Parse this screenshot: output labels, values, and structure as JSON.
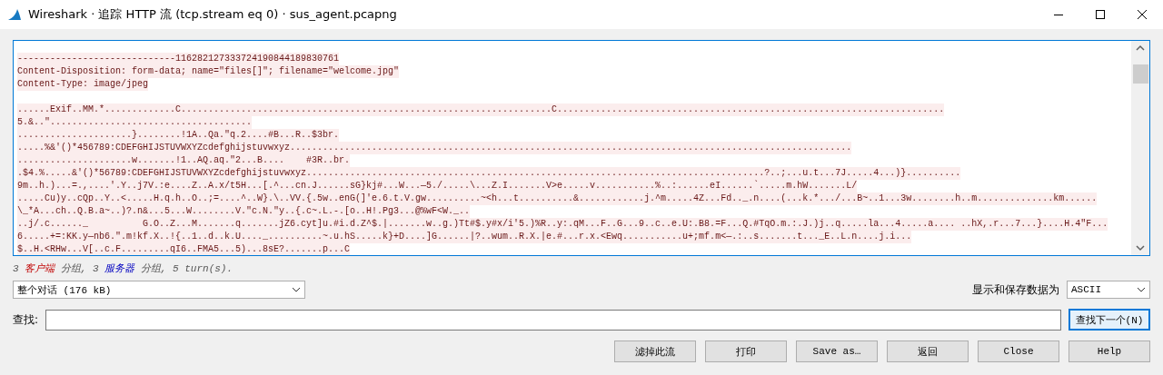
{
  "window": {
    "title": "Wireshark · 追踪 HTTP 流 (tcp.stream eq 0) · sus_agent.pcapng"
  },
  "stream": {
    "lines": [
      {
        "kind": "data",
        "color": "#fbeded",
        "text": "-----------------------------116282127333724190844189830761"
      },
      {
        "kind": "data",
        "color": "#fbeded",
        "text": "Content-Disposition: form-data; name=\"files[]\"; filename=\"welcome.jpg\""
      },
      {
        "kind": "data",
        "color": "#fbeded",
        "text": "Content-Type: image/jpeg"
      },
      {
        "kind": "blank"
      },
      {
        "kind": "data",
        "color": "#fbeded",
        "text": "......Exif..MM.*.............C....................................................................C......................................................................."
      },
      {
        "kind": "data",
        "color": "#fbeded",
        "text": "5.&..\"....................................."
      },
      {
        "kind": "data",
        "color": "#fbeded",
        "text": ".....................}........!1A..Qa.\"q.2....#B...R..$3br."
      },
      {
        "kind": "data",
        "color": "#fbeded",
        "text": ".....%&'()*456789:CDEFGHIJSTUVWXYZcdefghijstuvwxyz......................................................................................................."
      },
      {
        "kind": "data",
        "color": "#fbeded",
        "text": ".....................w.......!1..AQ.aq.\"2...B....    #3R..br."
      },
      {
        "kind": "data",
        "color": "#fbeded",
        "text": ".$4.%.....&'()*56789:CDEFGHIJSTUVWXYZcdefghijstuvwxyz....................................................................................?..;...u.t...7J.....4...)}.........."
      },
      {
        "kind": "data",
        "color": "#fbeded",
        "text": "9m..h.)...=.,....'.Y..j7V.:e....Z..A.x/t5H...[.^...cn.J......sG}kj#...W...—5./.....\\...Z.I.......V>e.....v...........%..:......eI......`.....m.hW.......L/"
      },
      {
        "kind": "data",
        "color": "#fbeded",
        "text": ".....Cu)y..cQp..Y..<.....H.q.h..O..;=....^..W}.\\..VV.{.5w..enG(]'e.6.t.V.gw..........~<h...t..........&............j.^m.....4Z...Fd.._.n....(...k.*.../...B~..1...3w........h..m..............km......"
      },
      {
        "kind": "data",
        "color": "#fbeded",
        "text": "\\_*A...ch..Q.B.a~..)?.n&...5...W........V.\"c.N.\"y..{.c~.L.-.[o..H!.Pg3...@%wF<W._.."
      },
      {
        "kind": "data",
        "color": "#fbeded",
        "text": "..j/.c......_          G.O..Z...M.......q.......jZ6.cyt]u.#i.d.Z^$.|.......w..g.)Tt#$.y#x/i'5.)%R..y:.qM...F..G...9..c..e.U:.B8.=F...Q.#TqO.m.:.J.)j..q.....la...4.....a.... ..hX,.r...7...}....H.4\"F..."
      },
      {
        "kind": "data",
        "color": "#fbeded",
        "text": "6.....+=:KK.y—nb6.\".m!kf.X..!{..1..d..k.U...._..........~.u.hS.....k}+D....]G......|?..wum..R.X.|e.#...r.x.<Ewq...........u+;mf.m<—.:..s.......t..._E..L.n....j.i..."
      },
      {
        "kind": "data",
        "color": "#fbeded",
        "text": "$..H.<RHw...V[..c.F.........qI6..FMA5...5)...8sE?.......p...C"
      }
    ]
  },
  "status": {
    "parts": [
      {
        "kind": "plain",
        "text": "3 "
      },
      {
        "kind": "client",
        "text": "客户端"
      },
      {
        "kind": "plain",
        "text": " 分组, 3 "
      },
      {
        "kind": "server",
        "text": "服务器"
      },
      {
        "kind": "plain",
        "text": " 分组, 5 turn(s)."
      }
    ]
  },
  "conversation_select": {
    "value": "整个对话 (176 kB)"
  },
  "format_label": "显示和保存数据为",
  "format_select": {
    "value": "ASCII"
  },
  "find": {
    "label": "查找:",
    "button": "查找下一个(N)"
  },
  "buttons": [
    "滤掉此流",
    "打印",
    "Save as…",
    "返回",
    "Close",
    "Help"
  ]
}
